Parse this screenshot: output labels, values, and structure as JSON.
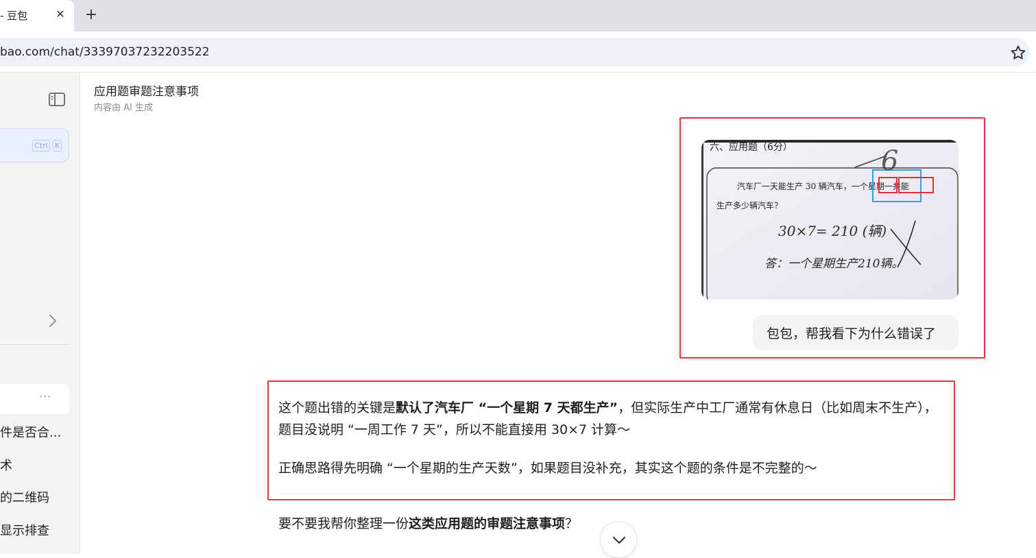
{
  "browser": {
    "tab_title": "- 豆包",
    "tab_close": "✕",
    "new_tab": "+",
    "url": "bao.com/chat/33397037232203522"
  },
  "sidebar": {
    "search_shortcut": [
      "Ctrl",
      "K"
    ],
    "history_more": "···",
    "history_items": [
      {
        "label": "件是否合..."
      },
      {
        "label": "术"
      },
      {
        "label": "的二维码"
      },
      {
        "label": "显示排查"
      }
    ]
  },
  "conversation": {
    "title": "应用题审题注意事项",
    "subtitle": "内容由 AI 生成"
  },
  "user_message": {
    "image_text": {
      "heading": "六、应用题（6分）",
      "line1": "汽车厂一天能生产 30 辆汽车，一个星期一共能",
      "line2": "生产多少辆汽车？",
      "equation": "30×7= 210 (辆)",
      "answer": "答：一个星期生产210辆。",
      "score_mark": "6"
    },
    "text": "包包，帮我看下为什么错误了"
  },
  "ai_message": {
    "p1_prefix": "这个题出错的关键是",
    "p1_bold": "默认了汽车厂 “一个星期 7 天都生产”",
    "p1_suffix": "，但实际生产中工厂通常有休息日（比如周末不生产），题目没说明 “一周工作 7 天”，所以不能直接用 30×7 计算～",
    "p2": "正确思路得先明确 “一个星期的生产天数”，如果题目没补充，其实这个题的条件是不完整的～",
    "p3_prefix": "要不要我帮你整理一份",
    "p3_bold": "这类应用题的审题注意事项",
    "p3_suffix": "？"
  },
  "colors": {
    "highlight_border": "#e8343a",
    "sidebar_bg": "#f3f4f6",
    "search_bg": "#eaf0fe",
    "user_bubble_bg": "#f3f4f6"
  },
  "icons": [
    "star-icon",
    "panel-toggle-icon",
    "chevron-right-icon",
    "chevron-down-icon",
    "close-icon",
    "plus-icon"
  ]
}
